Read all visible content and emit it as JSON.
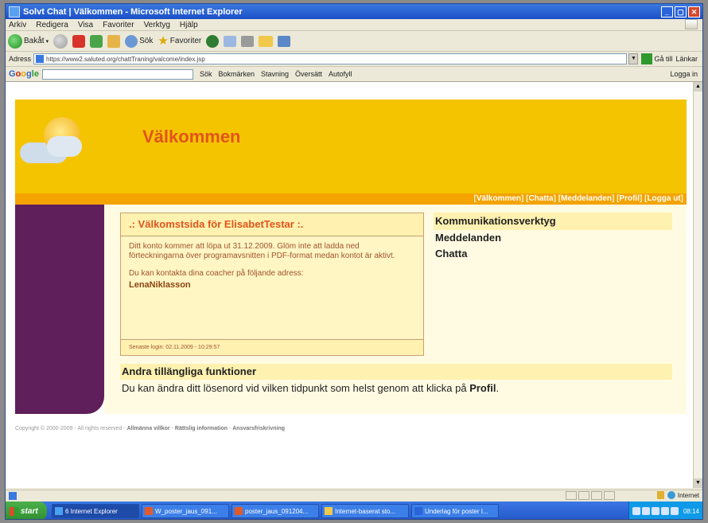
{
  "window": {
    "title": "Solvt Chat | Välkommen - Microsoft Internet Explorer"
  },
  "menu": [
    "Arkiv",
    "Redigera",
    "Visa",
    "Favoriter",
    "Verktyg",
    "Hjälp"
  ],
  "toolbar": {
    "back": "Bakåt",
    "search": "Sök",
    "favorites": "Favoriter"
  },
  "address": {
    "label": "Adress",
    "url": "https://www2.saluted.org/chattTraning/valcome/index.jsp",
    "go": "Gå till",
    "links": "Länkar"
  },
  "google": {
    "logo": [
      "G",
      "o",
      "o",
      "g",
      "le"
    ],
    "items": [
      "Sök",
      "Bokmärken",
      "Stavning",
      "Översätt",
      "Autofyll"
    ],
    "signin": "Logga in"
  },
  "site": {
    "welcome": "Välkommen",
    "nav": [
      "Välkommen",
      "Chatta",
      "Meddelanden",
      "Profil",
      "Logga ut"
    ],
    "box": {
      "heading": ".: Välkomstsida för ElisabetTestar :.",
      "text1": "Ditt konto kommer att löpa ut 31.12.2009. Glöm inte att ladda ned förteckningarna över programavsnitten i PDF-format medan kontot är aktivt.",
      "text2": "Du kan kontakta dina coacher på följande adress:",
      "coach": "LenaNiklasson",
      "lastlogin": "Senaste login: 02.11.2009 - 10:29:57"
    },
    "tools": {
      "heading": "Kommunikationsverktyg",
      "items": [
        "Meddelanden",
        "Chatta"
      ]
    },
    "other": {
      "heading": "Andra tillängliga funktioner",
      "text": "Du kan ändra ditt lösenord vid vilken tidpunkt som helst genom att klicka på",
      "link": "Profil",
      "end": "."
    },
    "footer": {
      "copyright": "Copyright © 2000-2009 - All rights reserved -",
      "links": [
        "Allmänna villkor",
        "Rättslig information",
        "Ansvarsfriskrivning"
      ]
    }
  },
  "status": {
    "zone": "Internet"
  },
  "taskbar": {
    "start": "start",
    "tasks": [
      {
        "label": "6 Internet Explorer",
        "icon": "ie"
      },
      {
        "label": "W_poster_jaus_091...",
        "icon": "pp"
      },
      {
        "label": "poster_jaus_091204...",
        "icon": "pp"
      },
      {
        "label": "Internet-baserat sto...",
        "icon": "fo"
      },
      {
        "label": "Underlag för poster I...",
        "icon": "wd"
      }
    ],
    "clock": "08:14"
  }
}
